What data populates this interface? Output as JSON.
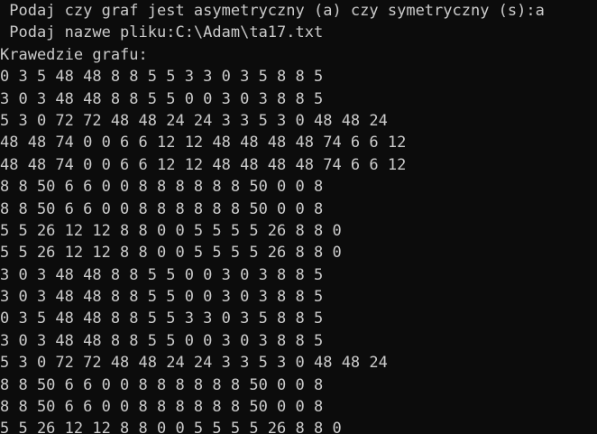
{
  "console": {
    "prompt_line": " Podaj czy graf jest asymetryczny (a) czy symetryczny (s):a",
    "file_line": " Podaj nazwe pliku:C:\\Adam\\ta17.txt",
    "edges_header": "Krawedzie grafu:",
    "rows": [
      "0 3 5 48 48 8 8 5 5 3 3 0 3 5 8 8 5",
      "3 0 3 48 48 8 8 5 5 0 0 3 0 3 8 8 5",
      "5 3 0 72 72 48 48 24 24 3 3 5 3 0 48 48 24",
      "48 48 74 0 0 6 6 12 12 48 48 48 48 74 6 6 12",
      "48 48 74 0 0 6 6 12 12 48 48 48 48 74 6 6 12",
      "8 8 50 6 6 0 0 8 8 8 8 8 8 50 0 0 8",
      "8 8 50 6 6 0 0 8 8 8 8 8 8 50 0 0 8",
      "5 5 26 12 12 8 8 0 0 5 5 5 5 26 8 8 0",
      "5 5 26 12 12 8 8 0 0 5 5 5 5 26 8 8 0",
      "3 0 3 48 48 8 8 5 5 0 0 3 0 3 8 8 5",
      "3 0 3 48 48 8 8 5 5 0 0 3 0 3 8 8 5",
      "0 3 5 48 48 8 8 5 5 3 3 0 3 5 8 8 5",
      "3 0 3 48 48 8 8 5 5 0 0 3 0 3 8 8 5",
      "5 3 0 72 72 48 48 24 24 3 3 5 3 0 48 48 24",
      "8 8 50 6 6 0 0 8 8 8 8 8 8 50 0 0 8",
      "8 8 50 6 6 0 0 8 8 8 8 8 8 50 0 0 8",
      "5 5 26 12 12 8 8 0 0 5 5 5 5 26 8 8 0"
    ]
  },
  "colors": {
    "background": "#0c0c0c",
    "text": "#cccccc"
  }
}
